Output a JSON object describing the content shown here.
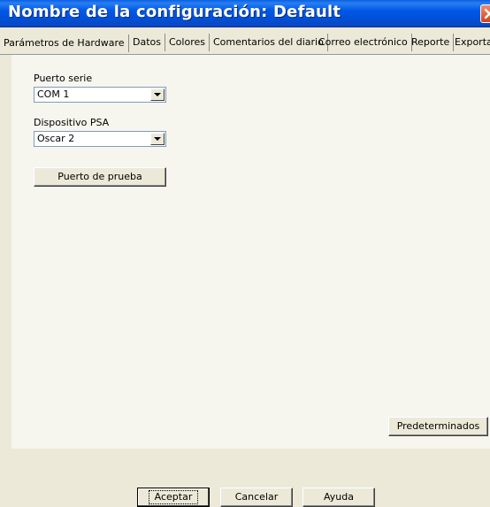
{
  "window": {
    "title": "Nombre de la configuración: Default"
  },
  "tabs": [
    "Parámetros de Hardware",
    "Datos",
    "Colores",
    "Comentarios del diario",
    "Correo electrónico",
    "Reporte",
    "Exporta"
  ],
  "hardware": {
    "serial_port_label": "Puerto serie",
    "serial_port_value": "COM 1",
    "psa_device_label": "Dispositivo PSA",
    "psa_device_value": "Oscar 2",
    "test_port_button": "Puerto de prueba",
    "defaults_button": "Predeterminados"
  },
  "buttons": {
    "accept": "Aceptar",
    "cancel": "Cancelar",
    "help": "Ayuda"
  },
  "colors": {
    "titlebar": "#0058e6",
    "face": "#ece9d8",
    "panel": "#f6f5ee",
    "close": "#d5401f"
  }
}
